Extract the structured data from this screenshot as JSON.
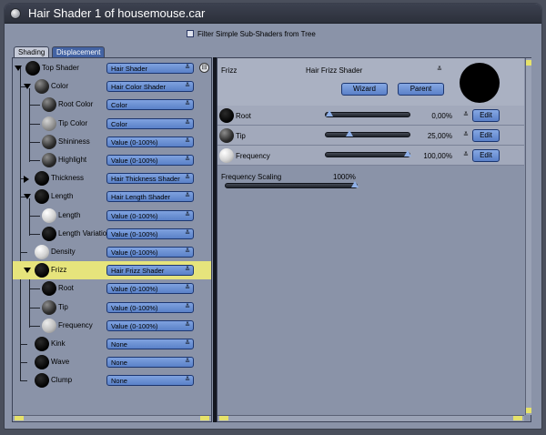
{
  "window": {
    "title": "Hair Shader 1 of housemouse.car",
    "filter_label": "Filter Simple Sub-Shaders from Tree"
  },
  "tabs": [
    {
      "label": "Shading",
      "active": true
    },
    {
      "label": "Displacement",
      "active": false
    }
  ],
  "tree": [
    {
      "label": "Top Shader",
      "value": "Hair Shader",
      "depth": 0,
      "ball": "black",
      "expander": "open"
    },
    {
      "label": "Color",
      "value": "Hair Color Shader",
      "depth": 1,
      "ball": "dark",
      "expander": "open"
    },
    {
      "label": "Root Color",
      "value": "Color",
      "depth": 2,
      "ball": "dark",
      "expander": ""
    },
    {
      "label": "Tip Color",
      "value": "Color",
      "depth": 2,
      "ball": "grey",
      "expander": ""
    },
    {
      "label": "Shininess",
      "value": "Value (0-100%)",
      "depth": 2,
      "ball": "dark",
      "expander": ""
    },
    {
      "label": "Highlight",
      "value": "Value (0-100%)",
      "depth": 2,
      "ball": "dark",
      "expander": ""
    },
    {
      "label": "Thickness",
      "value": "Hair Thickness Shader",
      "depth": 1,
      "ball": "black",
      "expander": "closed"
    },
    {
      "label": "Length",
      "value": "Hair Length Shader",
      "depth": 1,
      "ball": "black",
      "expander": "open"
    },
    {
      "label": "Length",
      "value": "Value (0-100%)",
      "depth": 2,
      "ball": "white",
      "expander": ""
    },
    {
      "label": "Length Variatio",
      "value": "Value (0-100%)",
      "depth": 2,
      "ball": "black",
      "expander": ""
    },
    {
      "label": "Density",
      "value": "Value (0-100%)",
      "depth": 1,
      "ball": "white",
      "expander": ""
    },
    {
      "label": "Frizz",
      "value": "Hair Frizz Shader",
      "depth": 1,
      "ball": "black",
      "expander": "open",
      "selected": true
    },
    {
      "label": "Root",
      "value": "Value (0-100%)",
      "depth": 2,
      "ball": "black",
      "expander": ""
    },
    {
      "label": "Tip",
      "value": "Value (0-100%)",
      "depth": 2,
      "ball": "dark",
      "expander": ""
    },
    {
      "label": "Frequency",
      "value": "Value (0-100%)",
      "depth": 2,
      "ball": "light",
      "expander": ""
    },
    {
      "label": "Kink",
      "value": "None",
      "depth": 1,
      "ball": "black",
      "expander": ""
    },
    {
      "label": "Wave",
      "value": "None",
      "depth": 1,
      "ball": "black",
      "expander": ""
    },
    {
      "label": "Clump",
      "value": "None",
      "depth": 1,
      "ball": "black",
      "expander": ""
    }
  ],
  "detail": {
    "name": "Frizz",
    "shader": "Hair Frizz Shader",
    "wizard_label": "Wizard",
    "parent_label": "Parent",
    "params": [
      {
        "label": "Root",
        "value": "0,00%",
        "fraction": 0.0,
        "ball": "black",
        "edit_label": "Edit"
      },
      {
        "label": "Tip",
        "value": "25,00%",
        "fraction": 0.25,
        "ball": "dark",
        "edit_label": "Edit"
      },
      {
        "label": "Frequency",
        "value": "100,00%",
        "fraction": 1.0,
        "ball": "white",
        "edit_label": "Edit"
      }
    ],
    "frequency_scaling": {
      "label": "Frequency Scaling",
      "value": "1000%",
      "fraction": 1.0
    }
  }
}
